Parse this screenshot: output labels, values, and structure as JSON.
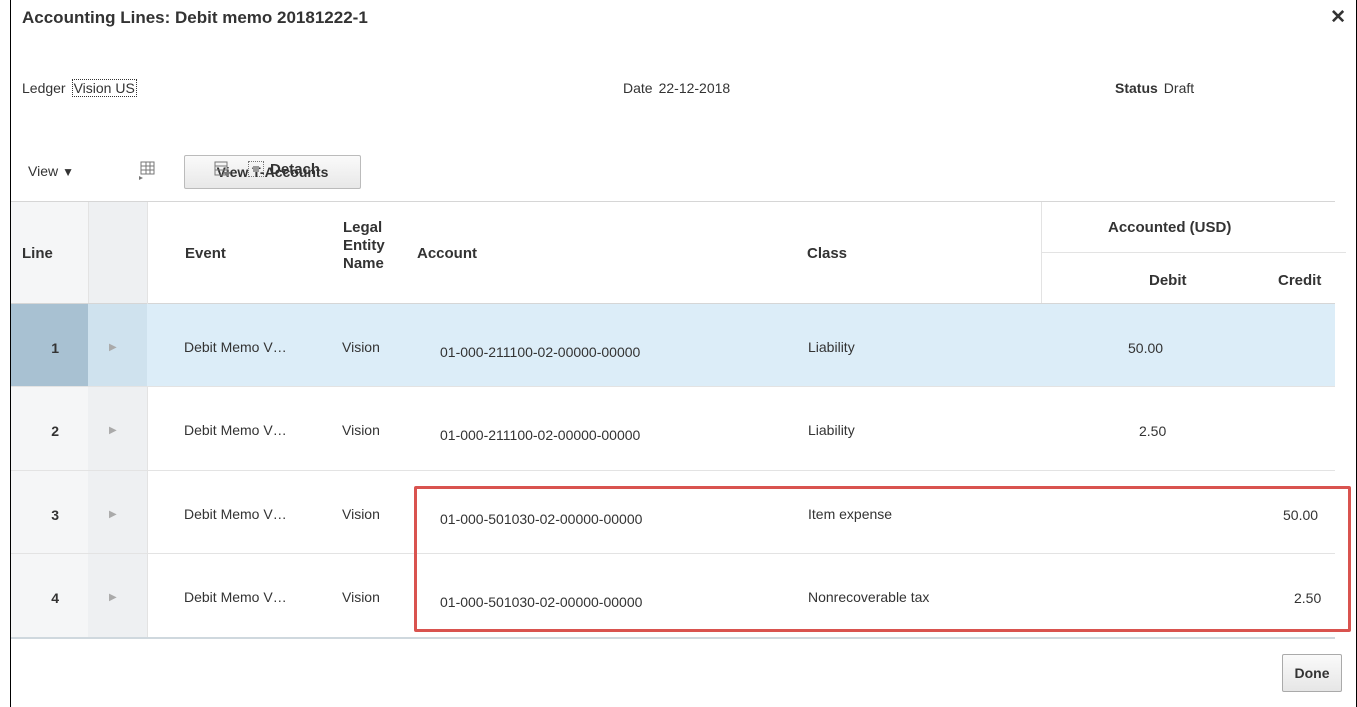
{
  "dialog": {
    "title": "Accounting Lines: Debit memo 20181222-1",
    "close_label": "✕",
    "done_label": "Done"
  },
  "header": {
    "ledger_label": "Ledger",
    "ledger_value": "Vision US",
    "date_label": "Date",
    "date_value": "22-12-2018",
    "status_label": "Status",
    "status_value": "Draft"
  },
  "toolbar": {
    "view_label": "View",
    "view_t_accounts_label": "View T-Accounts",
    "detach_label": "Detach"
  },
  "table": {
    "headers": {
      "line": "Line",
      "event": "Event",
      "legal_entity_1": "Legal",
      "legal_entity_2": "Entity",
      "legal_entity_3": "Name",
      "account": "Account",
      "class": "Class",
      "accounted": "Accounted (USD)",
      "debit": "Debit",
      "credit": "Credit"
    },
    "rows": [
      {
        "line": "1",
        "event": "Debit Memo V…",
        "legal_entity": "Vision",
        "account": "01-000-211100-02-00000-00000",
        "class": "Liability",
        "debit": "50.00",
        "credit": ""
      },
      {
        "line": "2",
        "event": "Debit Memo V…",
        "legal_entity": "Vision",
        "account": "01-000-211100-02-00000-00000",
        "class": "Liability",
        "debit": "2.50",
        "credit": ""
      },
      {
        "line": "3",
        "event": "Debit Memo V…",
        "legal_entity": "Vision",
        "account": "01-000-501030-02-00000-00000",
        "class": "Item expense",
        "debit": "",
        "credit": "50.00"
      },
      {
        "line": "4",
        "event": "Debit Memo V…",
        "legal_entity": "Vision",
        "account": "01-000-501030-02-00000-00000",
        "class": "Nonrecoverable tax",
        "debit": "",
        "credit": "2.50"
      }
    ]
  },
  "colors": {
    "selected_row": "#dcedf8",
    "highlight_border": "#d9534f"
  }
}
